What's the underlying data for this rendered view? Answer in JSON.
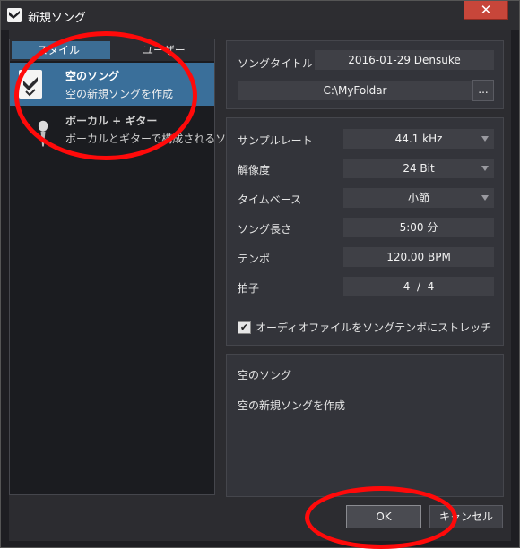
{
  "window": {
    "title": "新規ソング",
    "close_glyph": "✕"
  },
  "left_panel": {
    "tabs": [
      {
        "label": "スタイル"
      },
      {
        "label": "ユーザー"
      }
    ],
    "items": [
      {
        "name": "空のソング",
        "desc": "空の新規ソングを作成",
        "icon": "empty-song-icon",
        "selected": true
      },
      {
        "name": "ボーカル + ギター",
        "desc": "ボーカルとギターで構成されるソング",
        "icon": "microphone-icon",
        "selected": false
      }
    ]
  },
  "song_panel": {
    "title_label": "ソングタイトル",
    "title_value": "2016-01-29 Densuke",
    "path_value": "C:\\MyFoldar",
    "browse_label": "..."
  },
  "settings": {
    "sample_rate_label": "サンプルレート",
    "sample_rate_value": "44.1 kHz",
    "resolution_label": "解像度",
    "resolution_value": "24 Bit",
    "timebase_label": "タイムベース",
    "timebase_value": "小節",
    "song_length_label": "ソング長さ",
    "song_length_value": "5:00 分",
    "tempo_label": "テンポ",
    "tempo_value": "120.00 BPM",
    "time_sig_label": "拍子",
    "time_sig_value": "4  /  4",
    "stretch_label": "オーディオファイルをソングテンポにストレッチ",
    "stretch_checked": "✔"
  },
  "description_panel": {
    "title": "空のソング",
    "text": "空の新規ソングを作成"
  },
  "footer": {
    "ok_label": "OK",
    "cancel_label": "キャンセル"
  },
  "colors": {
    "accent": "#3a6f9a",
    "annotation": "#ff0a0a"
  }
}
